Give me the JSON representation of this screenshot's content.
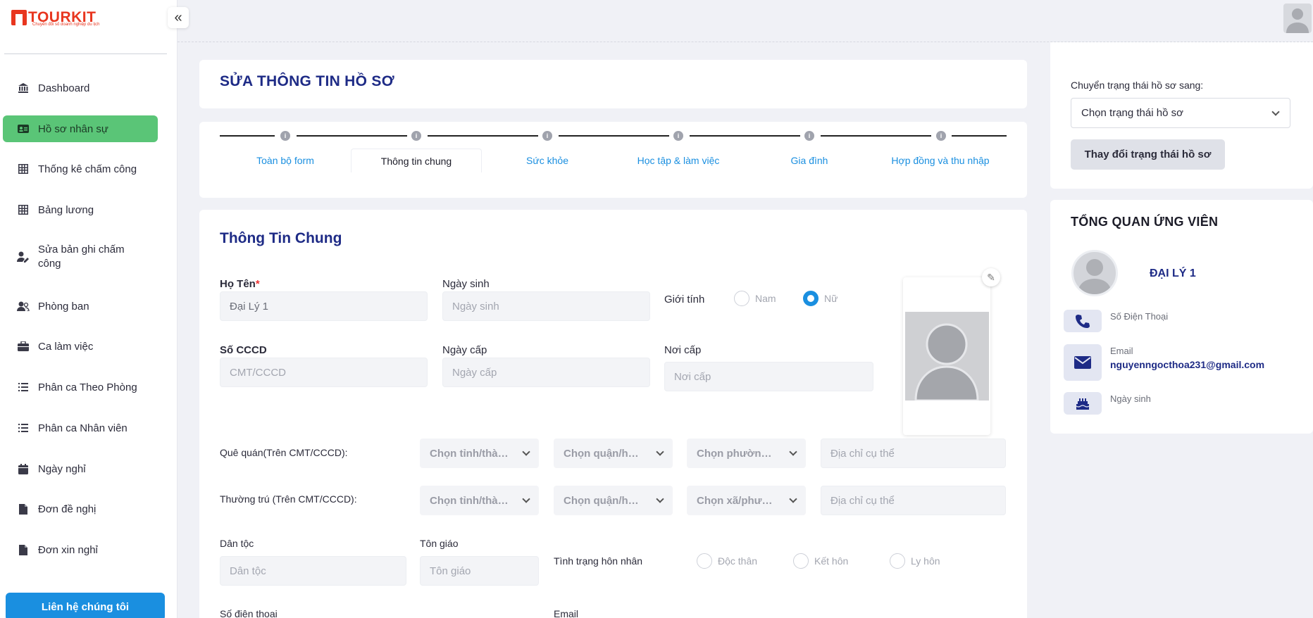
{
  "brand": {
    "name": "TOURKIT",
    "tagline": "Chuyển đổi số doanh nghiệp du lịch"
  },
  "sidebar": {
    "items": [
      {
        "label": "Dashboard",
        "icon": "bank-icon"
      },
      {
        "label": "Hồ sơ nhân sự",
        "icon": "id-card-icon",
        "active": true
      },
      {
        "label": "Thống kê chấm công",
        "icon": "table-icon"
      },
      {
        "label": "Bảng lương",
        "icon": "table-icon"
      },
      {
        "label": "Sửa bản ghi chấm công",
        "icon": "user-edit-icon"
      },
      {
        "label": "Phòng ban",
        "icon": "users-icon"
      },
      {
        "label": "Ca làm việc",
        "icon": "briefcase-icon"
      },
      {
        "label": "Phân ca Theo Phòng",
        "icon": "list-icon"
      },
      {
        "label": "Phân ca Nhân viên",
        "icon": "list-icon"
      },
      {
        "label": "Ngày nghỉ",
        "icon": "calendar-icon"
      },
      {
        "label": "Đơn đề nghị",
        "icon": "file-icon"
      },
      {
        "label": "Đơn xin nghỉ",
        "icon": "file-icon"
      }
    ],
    "contact_label": "Liên hệ chúng tôi"
  },
  "page": {
    "title": "SỬA THÔNG TIN HỒ SƠ"
  },
  "tabs": [
    "Toàn bộ form",
    "Thông tin chung",
    "Sức khỏe",
    "Học tập & làm việc",
    "Gia đình",
    "Hợp đồng và thu nhập"
  ],
  "tab_dot": "i",
  "form": {
    "section_title": "Thông Tin Chung",
    "name_label": "Họ Tên",
    "required_mark": "*",
    "name_value": "Đại Lý 1",
    "dob_label": "Ngày sinh",
    "dob_placeholder": "Ngày sinh",
    "gender_label": "Giới tính",
    "gender_male": "Nam",
    "gender_female": "Nữ",
    "id_label": "Số CCCD",
    "id_placeholder": "CMT/CCCD",
    "issue_date_label": "Ngày cấp",
    "issue_date_placeholder": "Ngày cấp",
    "issue_place_label": "Nơi cấp",
    "issue_place_placeholder": "Nơi cấp",
    "hometown_label": "Quê quán(Trên CMT/CCCD):",
    "hometown_province": "Chọn tỉnh/thành phố",
    "hometown_district": "Chọn quận/huyện",
    "hometown_ward": "Chọn phường/xã",
    "hometown_address": "Địa chỉ cụ thể",
    "residence_label": "Thường trú (Trên CMT/CCCD):",
    "residence_province": "Chọn tỉnh/thành phố",
    "residence_district": "Chọn quận/huyện",
    "residence_ward": "Chọn xã/phường",
    "residence_address": "Địa chỉ cụ thể",
    "ethnic_label": "Dân tộc",
    "ethnic_placeholder": "Dân tộc",
    "religion_label": "Tôn giáo",
    "religion_placeholder": "Tôn giáo",
    "marital_label": "Tình trạng hôn nhân",
    "marital_single": "Độc thân",
    "marital_married": "Kết hôn",
    "marital_divorced": "Ly hôn",
    "phone_label": "Số điện thoại",
    "email_label": "Email"
  },
  "status": {
    "label": "Chuyển trạng thái hồ sơ sang:",
    "select_placeholder": "Chọn trạng thái hồ sơ",
    "button": "Thay đổi trạng thái hồ sơ"
  },
  "overview": {
    "title": "TỔNG QUAN ỨNG VIÊN",
    "name": "ĐẠI LÝ 1",
    "phone_label": "Số Điện Thoại",
    "email_label": "Email",
    "email_value": "nguyenngocthoa231@gmail.com",
    "dob_label": "Ngày sinh"
  },
  "colors": {
    "accent": "#1a8fe0",
    "active_nav": "#5ac577",
    "title": "#1e2b86",
    "brand": "#e8361f"
  }
}
